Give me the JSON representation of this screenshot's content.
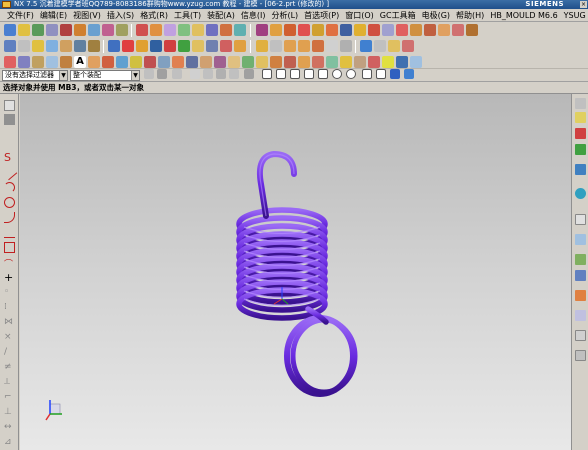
{
  "window": {
    "title": "NX 7.5 沉着建模学者班QQ789-8083186群购物www.yzug.com 教程 - 建模 - [06-2.prt (修改的) ]",
    "brand": "SIEMENS"
  },
  "menubar": {
    "items": [
      "文件(F)",
      "编辑(E)",
      "视图(V)",
      "插入(S)",
      "格式(R)",
      "工具(T)",
      "装配(A)",
      "信息(I)",
      "分析(L)",
      "首选项(P)",
      "窗口(O)",
      "GC工具箱",
      "电极(G)",
      "帮助(H)",
      "HB_MOULD M6.6",
      "YSUG"
    ]
  },
  "selection_bar": {
    "filter_value": "没有选择过滤器",
    "scope_value": "整个装配"
  },
  "cue_line": {
    "text": "选择对象并使用 MB3，或者双击某一对象"
  },
  "colors": {
    "spring": "#6a2be0",
    "spring_dark": "#3a128f",
    "spring_light": "#9a6af5"
  }
}
